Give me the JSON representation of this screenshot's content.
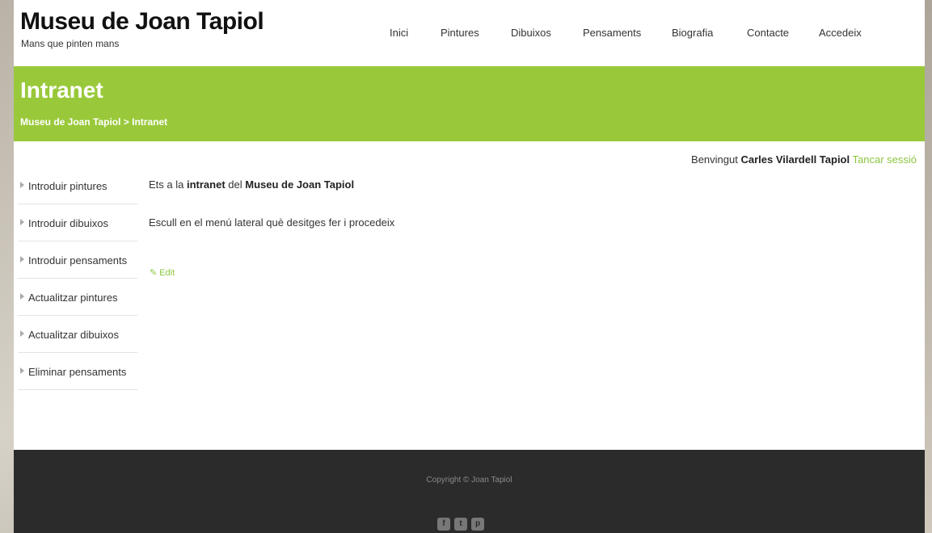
{
  "header": {
    "site_title": "Museu de Joan Tapiol",
    "tagline": "Mans que pinten mans",
    "nav": [
      "Inici",
      "Pintures",
      "Dibuixos",
      "Pensaments",
      "Biografia",
      "Contacte",
      "Accedeix"
    ]
  },
  "band": {
    "title": "Intranet",
    "breadcrumb": "Museu de Joan Tapiol > Intranet"
  },
  "welcome": {
    "prefix": "Benvingut",
    "user": "Carles Vilardell Tapiol",
    "logout": "Tancar sessió"
  },
  "sidebar": {
    "items": [
      {
        "label": "Introduir pintures"
      },
      {
        "label": "Introduir dibuixos"
      },
      {
        "label": "Introduir pensaments"
      },
      {
        "label": "Actualitzar pintures"
      },
      {
        "label": "Actualitzar dibuixos"
      },
      {
        "label": "Eliminar pensaments"
      }
    ]
  },
  "content": {
    "line1_pre": "Ets a la",
    "line1_bold1": "intranet",
    "line1_mid": "del",
    "line1_bold2": "Museu de Joan Tapiol",
    "line2": "Escull en el menú lateral què desitges fer i procedeix",
    "edit_label": "Edit"
  },
  "footer": {
    "copyright": "Copyright © Joan Tapiol",
    "social_icons": [
      "facebook-icon",
      "twitter-icon",
      "pinterest-icon"
    ]
  },
  "colors": {
    "accent": "#99c93a",
    "link": "#8cc63f",
    "footer_bg": "#2b2b2b"
  }
}
